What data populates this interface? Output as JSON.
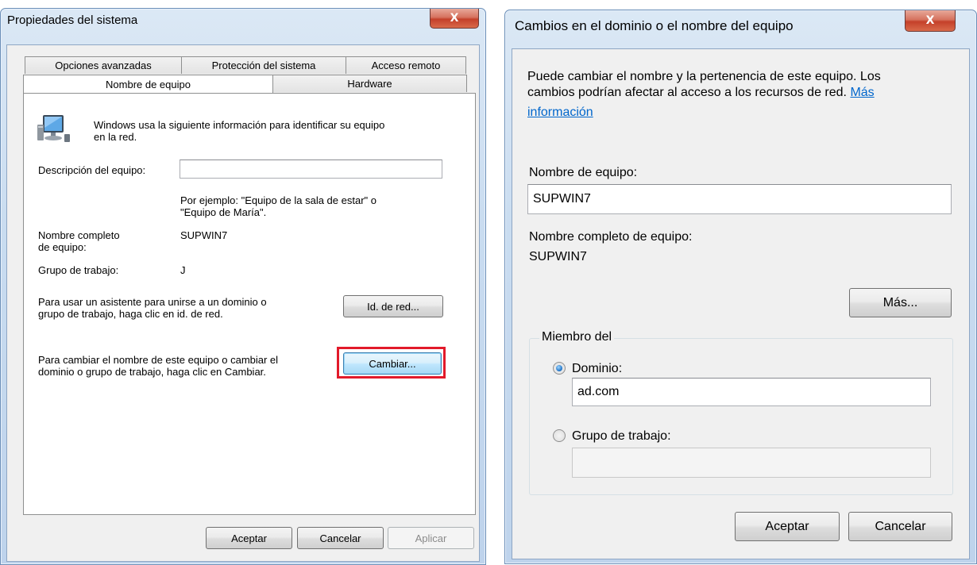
{
  "left_dialog": {
    "title": "Propiedades del sistema",
    "close_glyph": "X",
    "tabs_row1": [
      "Opciones avanzadas",
      "Protección del sistema",
      "Acceso remoto"
    ],
    "tabs_row2": [
      "Nombre de equipo",
      "Hardware"
    ],
    "active_tab": "Nombre de equipo",
    "intro_line1": "Windows usa la siguiente información para identificar su equipo",
    "intro_line2": "en la red.",
    "description_label": "Descripción del equipo:",
    "description_value": "",
    "example_line1": "Por ejemplo: \"Equipo de la sala de estar\" o",
    "example_line2": "\"Equipo de María\".",
    "fullname_label_line1": "Nombre completo",
    "fullname_label_line2": "de equipo:",
    "fullname_value": "SUPWIN7",
    "workgroup_label": "Grupo de trabajo:",
    "workgroup_value": "J",
    "network_id_text_line1": "Para usar un asistente para unirse a un dominio o",
    "network_id_text_line2": "grupo de trabajo, haga clic en id. de red.",
    "network_id_button": "Id. de red...",
    "change_text_line1": "Para cambiar el nombre de este equipo o cambiar el",
    "change_text_line2": "dominio o grupo de trabajo, haga clic en Cambiar.",
    "change_button": "Cambiar...",
    "ok_button": "Aceptar",
    "cancel_button": "Cancelar",
    "apply_button": "Aplicar",
    "icon": "computer-network-icon"
  },
  "right_dialog": {
    "title": "Cambios en el dominio o el nombre del equipo",
    "close_glyph": "X",
    "intro_line1": "Puede cambiar el nombre y la pertenencia de este equipo. Los",
    "intro_line2": "cambios podrían afectar al acceso a los recursos de red.",
    "more_info_link_part1": "Más",
    "more_info_link_part2": "información",
    "computer_name_label": "Nombre de equipo:",
    "computer_name_value": "SUPWIN7",
    "full_name_label": "Nombre completo de equipo:",
    "full_name_value": "SUPWIN7",
    "more_button": "Más...",
    "member_of_label": "Miembro del",
    "domain_radio_label": "Dominio:",
    "domain_selected": true,
    "domain_value": "ad.com",
    "workgroup_radio_label": "Grupo de trabajo:",
    "workgroup_value": "",
    "ok_button": "Aceptar",
    "cancel_button": "Cancelar"
  },
  "colors": {
    "highlight_border": "#e21a2a",
    "link": "#0066cc",
    "close_button": "#c4402a"
  }
}
